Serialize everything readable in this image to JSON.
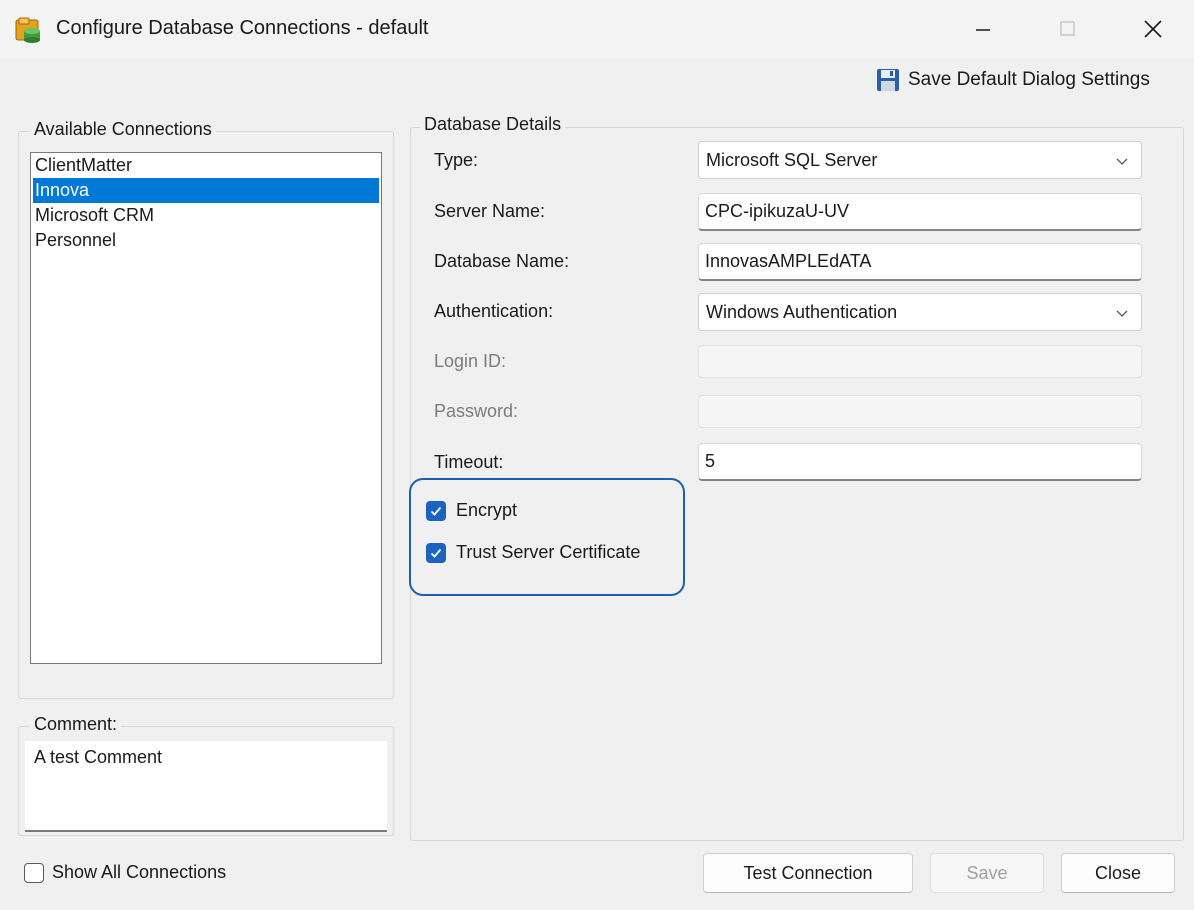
{
  "window": {
    "title": "Configure Database Connections - default",
    "controls": {
      "minimize": "minimize",
      "maximize": "maximize",
      "close": "close"
    }
  },
  "toolbar": {
    "save_default_label": "Save Default Dialog Settings"
  },
  "available": {
    "legend": "Available Connections",
    "items": [
      "ClientMatter",
      "Innova",
      "Microsoft CRM",
      "Personnel"
    ],
    "selected": "Innova"
  },
  "comment": {
    "legend": "Comment:",
    "value": "A test Comment"
  },
  "show_all": {
    "label": "Show All Connections",
    "checked": false
  },
  "details": {
    "legend": "Database Details",
    "type": {
      "label": "Type:",
      "value": "Microsoft SQL Server"
    },
    "server": {
      "label": "Server Name:",
      "value": "CPC-ipikuzaU-UV"
    },
    "database": {
      "label": "Database Name:",
      "value": "InnovasAMPLEdATA"
    },
    "auth": {
      "label": "Authentication:",
      "value": "Windows Authentication"
    },
    "login": {
      "label": "Login ID:",
      "value": ""
    },
    "password": {
      "label": "Password:",
      "value": ""
    },
    "timeout": {
      "label": "Timeout:",
      "value": "5"
    },
    "encrypt": {
      "label": "Encrypt",
      "checked": true
    },
    "trust": {
      "label": "Trust Server Certificate",
      "checked": true
    }
  },
  "buttons": {
    "test": "Test Connection",
    "save": "Save",
    "close": "Close"
  },
  "colors": {
    "accent": "#0078d7",
    "checkbox": "#1a64c0",
    "highlight": "#1c5fad"
  },
  "icons": {
    "app": "database-config-icon",
    "save": "floppy-disk-icon",
    "dropdown": "chevron-down-icon",
    "check": "checkmark-icon"
  }
}
